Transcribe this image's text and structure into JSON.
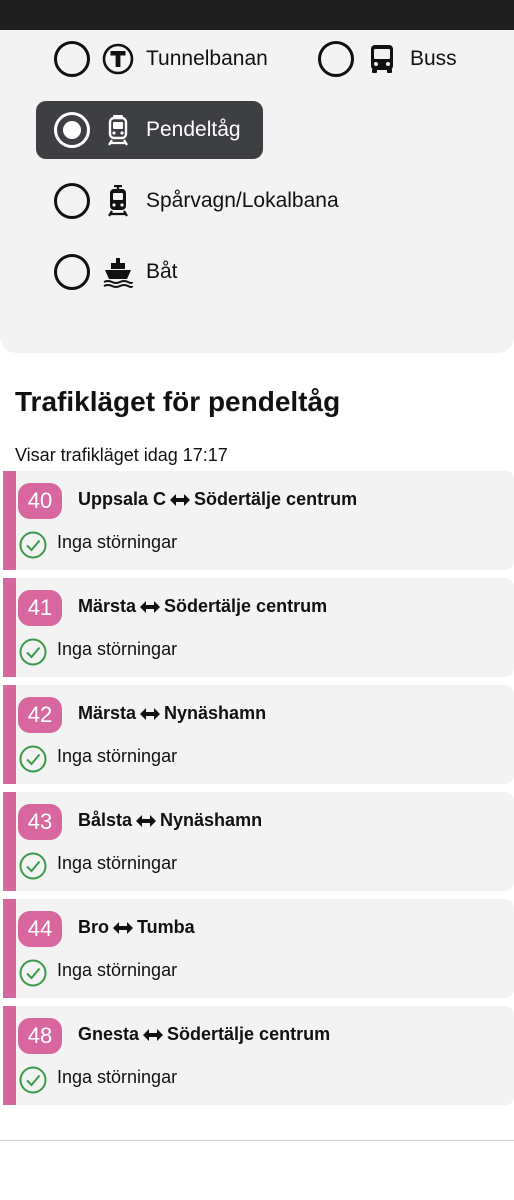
{
  "transport_modes": [
    {
      "id": "tunnelbanan",
      "label": "Tunnelbanan",
      "icon": "metro-t-icon",
      "selected": false
    },
    {
      "id": "buss",
      "label": "Buss",
      "icon": "bus-icon",
      "selected": false
    },
    {
      "id": "pendeltag",
      "label": "Pendeltåg",
      "icon": "commuter-train-icon",
      "selected": true
    },
    {
      "id": "sparvagn",
      "label": "Spårvagn/Lokalbana",
      "icon": "tram-icon",
      "selected": false
    },
    {
      "id": "bat",
      "label": "Båt",
      "icon": "boat-icon",
      "selected": false
    }
  ],
  "section": {
    "title": "Trafikläget för pendeltåg",
    "status_time": "Visar trafikläget idag 17:17"
  },
  "colors": {
    "line_accent": "#d4679e",
    "ok_green": "#3a9a4a",
    "selected_bg": "#3d3f43"
  },
  "lines": [
    {
      "number": "40",
      "from": "Uppsala C",
      "to": "Södertälje centrum",
      "status": "Inga störningar"
    },
    {
      "number": "41",
      "from": "Märsta",
      "to": "Södertälje centrum",
      "status": "Inga störningar"
    },
    {
      "number": "42",
      "from": "Märsta",
      "to": "Nynäshamn",
      "status": "Inga störningar"
    },
    {
      "number": "43",
      "from": "Bålsta",
      "to": "Nynäshamn",
      "status": "Inga störningar"
    },
    {
      "number": "44",
      "from": "Bro",
      "to": "Tumba",
      "status": "Inga störningar"
    },
    {
      "number": "48",
      "from": "Gnesta",
      "to": "Södertälje centrum",
      "status": "Inga störningar"
    }
  ]
}
